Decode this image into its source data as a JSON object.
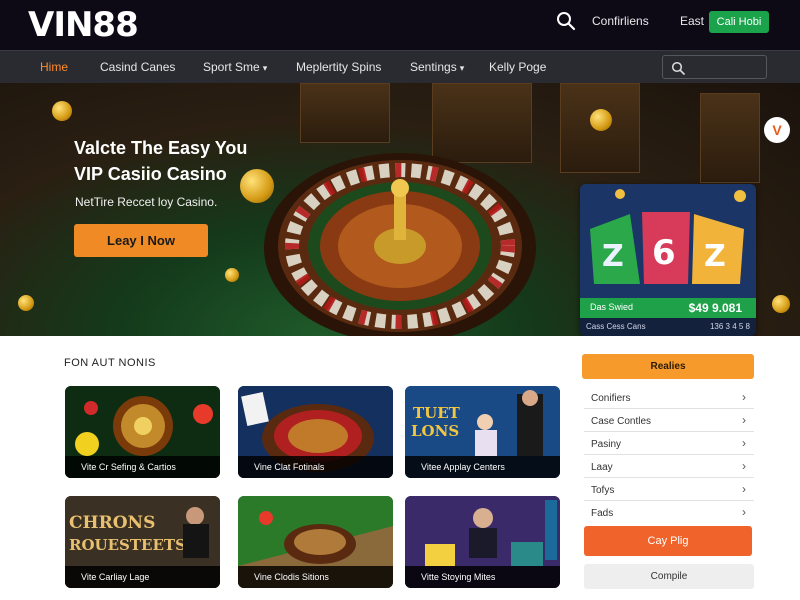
{
  "brand": {
    "logo": "VIN88",
    "accent": "#f08a24",
    "green": "#1aa34a"
  },
  "header": {
    "link_confirm": "Confirliens",
    "link_east": "East",
    "cta": "Cali Hobi"
  },
  "nav": {
    "items": [
      {
        "label": "Hime",
        "active": true
      },
      {
        "label": "Casind Canes",
        "active": false
      },
      {
        "label": "Sport Sme",
        "active": false,
        "dropdown": true
      },
      {
        "label": "Meplertity Spins",
        "active": false
      },
      {
        "label": "Sentings",
        "active": false,
        "dropdown": true
      },
      {
        "label": "Kelly Poge",
        "active": false
      }
    ],
    "search_placeholder": ""
  },
  "hero": {
    "title_line1": "Valcte The Easy You",
    "title_line2": "VIP Casiio Casino",
    "subtitle": "NetTire Reccet loy Casino.",
    "button": "Leay I Now",
    "badge": "V",
    "promo": {
      "label": "Das Swied",
      "amount": "$49 9.081",
      "footer_left": "Cass  Cess  Cans",
      "footer_right": "136 3 4 5 8"
    }
  },
  "games": {
    "section_title": "FON AUT NONIS",
    "tiles": [
      {
        "label": "Vite Cr Sefing & Cartios"
      },
      {
        "label": "Vine Clat Fotinals"
      },
      {
        "label": "Vitee Applay Centers"
      },
      {
        "label": "Vite Carliay Lage"
      },
      {
        "label": "Vine Clodis Sitions"
      },
      {
        "label": "Vitte Stoying Mites"
      }
    ]
  },
  "sidebar": {
    "header": "Realies",
    "items": [
      {
        "label": "Conifiers"
      },
      {
        "label": "Case Contles"
      },
      {
        "label": "Pasiny"
      },
      {
        "label": "Laay"
      },
      {
        "label": "Tofys"
      },
      {
        "label": "Fads"
      }
    ],
    "primary_button": "Cay Plig",
    "secondary_button": "Compile"
  }
}
